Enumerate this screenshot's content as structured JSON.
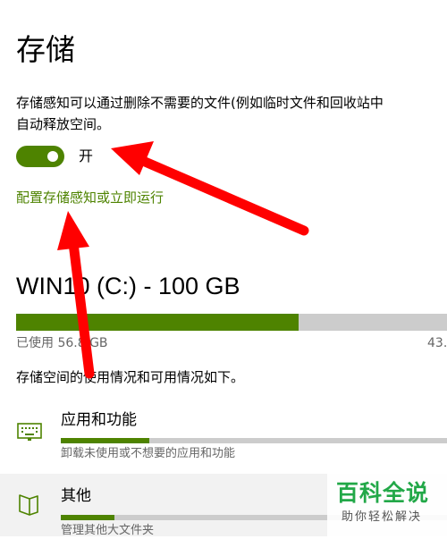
{
  "page": {
    "title": "存储"
  },
  "storage_sense": {
    "description_line1": "存储感知可以通过删除不需要的文件(例如临时文件和回收站中",
    "description_line2": "自动释放空间。",
    "toggle_state": "开",
    "toggle_on": true,
    "config_link": "配置存储感知或立即运行"
  },
  "drive": {
    "title": "WIN10 (C:) - 100 GB",
    "used_label": "已使用 56.8 GB",
    "free_label": "43.",
    "used_fraction": 0.656,
    "usage_summary": "存储空间的使用情况和可用情况如下。"
  },
  "categories": [
    {
      "title": "应用和功能",
      "description": "卸载未使用或不想要的应用和功能",
      "icon": "keyboard-icon",
      "fraction": 0.23
    },
    {
      "title": "其他",
      "description": "管理其他大文件夹",
      "icon": "folder-icon",
      "fraction": 0.14
    }
  ],
  "watermark": {
    "main": "百科全说",
    "sub": "助你轻松解决"
  },
  "colors": {
    "accent": "#4e8300",
    "bar_track": "#cccccc",
    "annotation_arrow": "#ff0000",
    "watermark_green": "#22a848"
  }
}
